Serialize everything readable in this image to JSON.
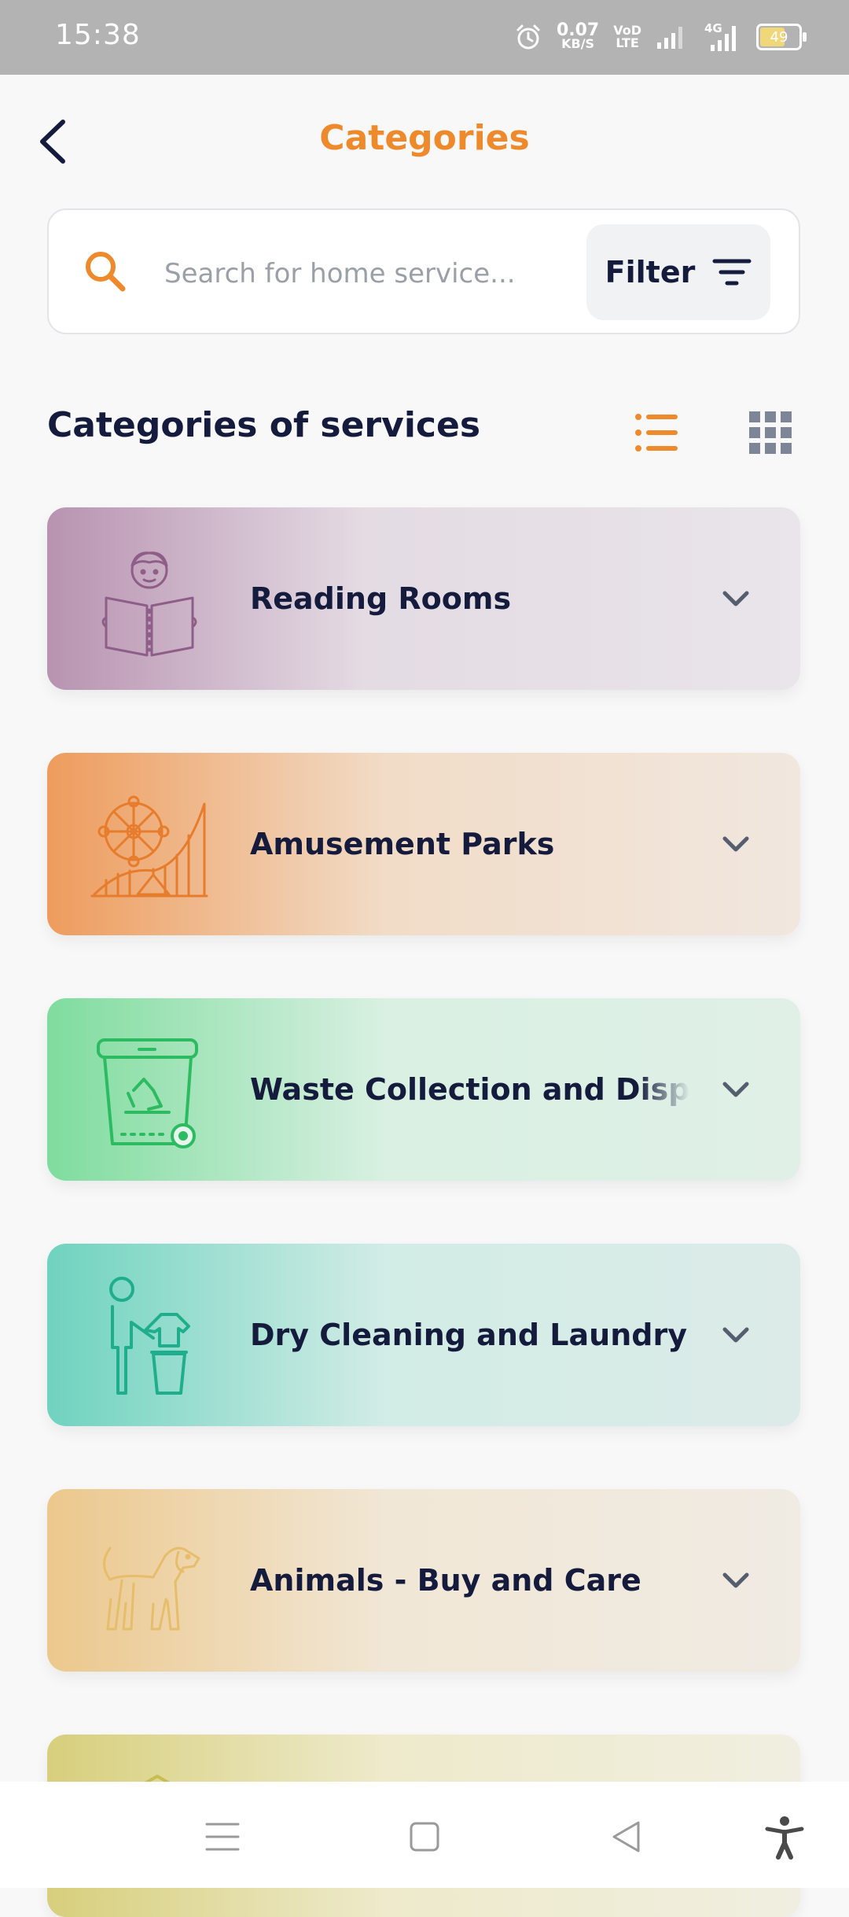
{
  "status_bar": {
    "time": "15:38",
    "net_speed_value": "0.07",
    "net_speed_unit": "KB/S",
    "volte_top": "VoD",
    "volte_bottom": "LTE",
    "network_type": "4G",
    "battery": "49"
  },
  "header": {
    "title": "Categories",
    "back_icon": "chevron-left-icon"
  },
  "search": {
    "placeholder": "Search for home service...",
    "value": "",
    "filter_label": "Filter"
  },
  "section": {
    "title": "Categories of services"
  },
  "colors": {
    "accent": "#ef8a2c",
    "text": "#141b3c"
  },
  "categories": [
    {
      "label": "Reading Rooms",
      "icon": "reader-icon",
      "color": "#b893b1"
    },
    {
      "label": "Amusement Parks",
      "icon": "ferris-wheel-icon",
      "color": "#ee9c5d"
    },
    {
      "label": "Waste Collection and Disposal",
      "icon": "recycle-bin-icon",
      "color": "#7fdc9e"
    },
    {
      "label": "Dry Cleaning and Laundry",
      "icon": "laundry-icon",
      "color": "#6fd3bf"
    },
    {
      "label": "Animals - Buy and Care",
      "icon": "dog-icon",
      "color": "#ecc88c"
    }
  ],
  "nav": {
    "menu_icon": "menu-icon",
    "home_icon": "home-square-icon",
    "back_icon": "back-triangle-icon",
    "accessibility_icon": "accessibility-icon"
  }
}
